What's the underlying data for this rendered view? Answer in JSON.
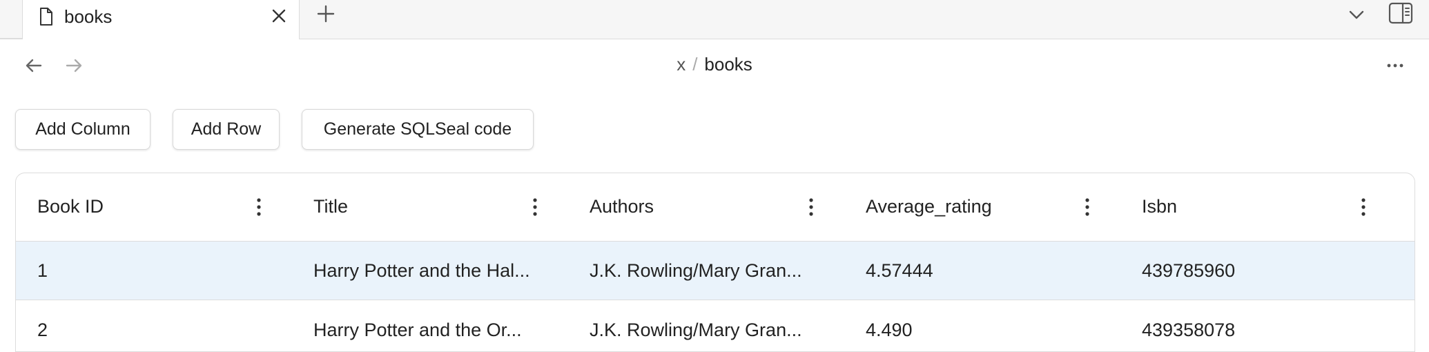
{
  "tab": {
    "title": "books"
  },
  "breadcrumb": {
    "parent": "x",
    "separator": "/",
    "current": "books"
  },
  "toolbar": {
    "add_column": "Add Column",
    "add_row": "Add Row",
    "generate": "Generate SQLSeal code"
  },
  "table": {
    "columns": [
      "Book ID",
      "Title",
      "Authors",
      "Average_rating",
      "Isbn"
    ],
    "rows": [
      {
        "cells": [
          "1",
          "Harry Potter and the Hal...",
          "J.K. Rowling/Mary Gran...",
          "4.57444",
          "439785960"
        ],
        "selected": true
      },
      {
        "cells": [
          "2",
          "Harry Potter and the Or...",
          "J.K. Rowling/Mary Gran...",
          "4.490",
          "439358078"
        ],
        "selected": false
      }
    ]
  },
  "icons": {
    "tab": "file-icon",
    "close": "close-icon",
    "new_tab": "plus-icon",
    "tab_list": "chevron-down-icon",
    "sidebar": "sidebar-toggle-icon",
    "back": "arrow-left-icon",
    "forward": "arrow-right-icon",
    "more": "more-horizontal-icon",
    "column_menu": "more-vertical-icon"
  },
  "colors": {
    "selected_row": "#eaf3fb",
    "border": "#dcdcdc"
  }
}
